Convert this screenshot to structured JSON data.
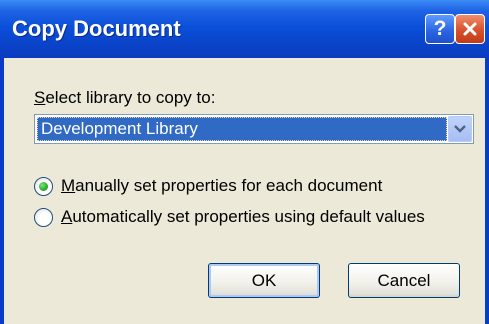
{
  "window": {
    "title": "Copy Document",
    "help_glyph": "?",
    "close_icon": "close-icon",
    "colors": {
      "titlebar": "#0A46CC",
      "body": "#ECE9D8",
      "selection": "#316AC5"
    }
  },
  "library": {
    "label_mnemonic": "S",
    "label_rest": "elect library to copy to:",
    "selected_value": "Development Library",
    "dropdown_icon": "chevron-down-icon"
  },
  "options": {
    "manual": {
      "mnemonic": "M",
      "rest": "anually set properties for each document",
      "checked": true
    },
    "auto": {
      "mnemonic": "A",
      "rest": "utomatically set properties using default values",
      "checked": false
    }
  },
  "buttons": {
    "ok_label": "OK",
    "cancel_label": "Cancel"
  }
}
